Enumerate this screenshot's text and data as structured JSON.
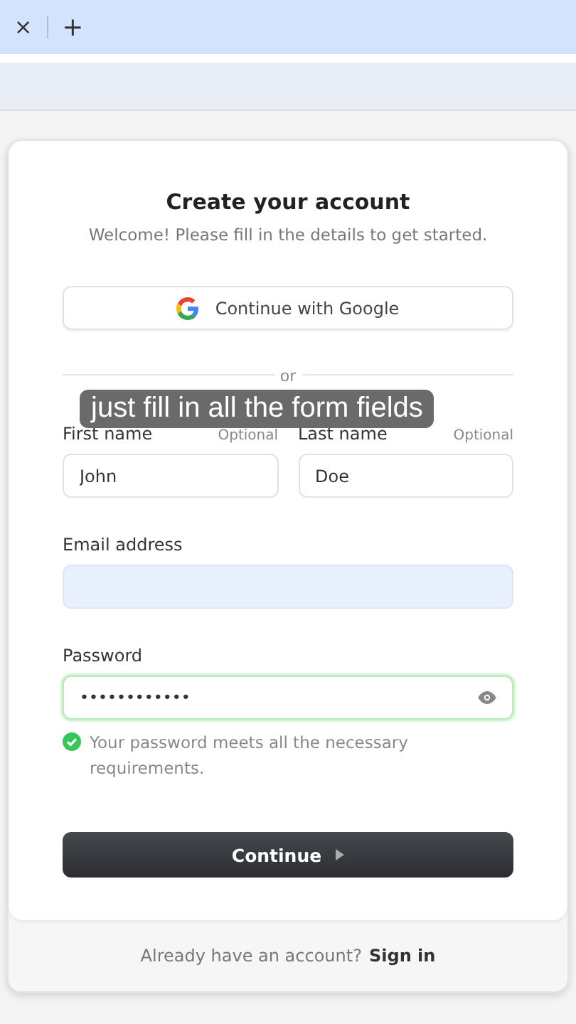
{
  "browser": {
    "tab_close": "×",
    "new_tab": "+"
  },
  "form": {
    "title": "Create your account",
    "subtitle": "Welcome! Please fill in the details to get started.",
    "google_button": "Continue with Google",
    "divider": "or",
    "name_fields": [
      {
        "label": "First name",
        "hint": "Optional",
        "value": "John"
      },
      {
        "label": "Last name",
        "hint": "Optional",
        "value": "Doe"
      }
    ],
    "email": {
      "label": "Email address"
    },
    "password": {
      "label": "Password",
      "value": "••••••••••••",
      "valid": true
    },
    "password_message": "Your password meets all the necessary requirements.",
    "continue_button": "Continue"
  },
  "footer": {
    "text": "Already have an account?",
    "link": "Sign in"
  },
  "caption": "just fill in all the form fields"
}
